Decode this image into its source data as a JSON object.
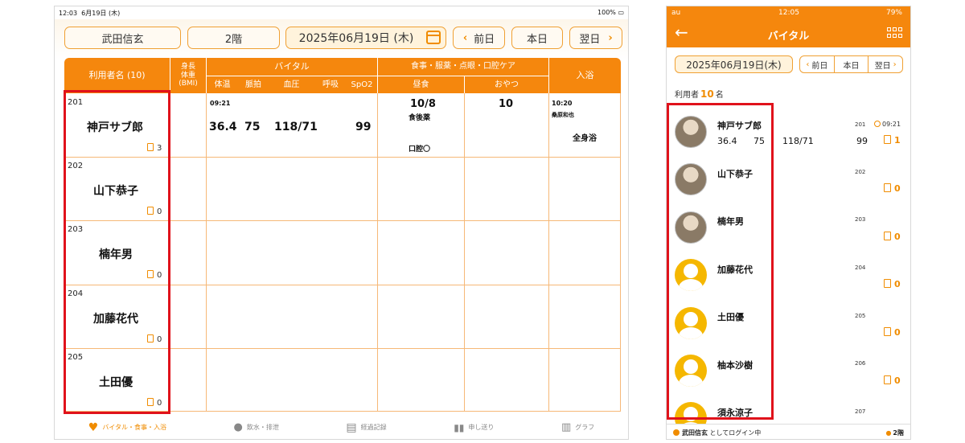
{
  "ipad": {
    "status": {
      "time": "12:03",
      "date": "6月19日 (木)",
      "battery": "100%"
    },
    "header": {
      "staff": "武田信玄",
      "floor": "2階",
      "date": "2025年06月19日 (木)",
      "prev": "前日",
      "today": "本日",
      "next": "翌日"
    },
    "columns": {
      "user": "利用者名 (10)",
      "height_weight": "身長\n体重\n(BMI)",
      "vital": "バイタル",
      "vital_sub": [
        "体温",
        "脈拍",
        "血圧",
        "呼吸",
        "SpO2"
      ],
      "meal": "食事・服薬・点眼・口腔ケア",
      "meal_sub": [
        "昼食",
        "おやつ"
      ],
      "bath": "入浴"
    },
    "rows": [
      {
        "room": "201",
        "name": "神戸サブ郎",
        "notes": "3",
        "vital_time": "09:21",
        "temp": "36.4",
        "pulse": "75",
        "bp": "118/71",
        "spo2": "99",
        "lunch": "10/8",
        "lunch_med": "食後薬",
        "lunch_oral": "口腔〇",
        "snack": "10",
        "bath_time": "10:20",
        "bath_staff": "桑原和也",
        "bath_type": "全身浴"
      },
      {
        "room": "202",
        "name": "山下恭子",
        "notes": "0"
      },
      {
        "room": "203",
        "name": "楠年男",
        "notes": "0"
      },
      {
        "room": "204",
        "name": "加藤花代",
        "notes": "0"
      },
      {
        "room": "205",
        "name": "土田優",
        "notes": "0"
      }
    ],
    "nav": [
      "バイタル・食事・入浴",
      "飲水・排泄",
      "経過記録",
      "申し送り",
      "グラフ"
    ]
  },
  "iphone": {
    "status": {
      "carrier": "au",
      "time": "12:05",
      "battery": "79%"
    },
    "title": "バイタル",
    "date": "2025年06月19日(木)",
    "prev": "前日",
    "today": "本日",
    "next": "翌日",
    "user_count_label": "利用者",
    "user_count": "10",
    "user_count_unit": "名",
    "patients": [
      {
        "name": "神戸サブ郎",
        "room": "201",
        "time": "09:21",
        "temp": "36.4",
        "pulse": "75",
        "bp": "118/71",
        "spo2": "99",
        "notes": "1"
      },
      {
        "name": "山下恭子",
        "room": "202",
        "notes": "0"
      },
      {
        "name": "楠年男",
        "room": "203",
        "notes": "0"
      },
      {
        "name": "加藤花代",
        "room": "204",
        "notes": "0"
      },
      {
        "name": "土田優",
        "room": "205",
        "notes": "0"
      },
      {
        "name": "柚本沙樹",
        "room": "206",
        "notes": "0"
      },
      {
        "name": "須永涼子",
        "room": "207"
      }
    ],
    "footer": {
      "staff": "武田信玄",
      "login_text": "としてログイン中",
      "floor": "2階"
    }
  },
  "colors": {
    "accent": "#f5870d",
    "highlight": "#e0121b"
  }
}
